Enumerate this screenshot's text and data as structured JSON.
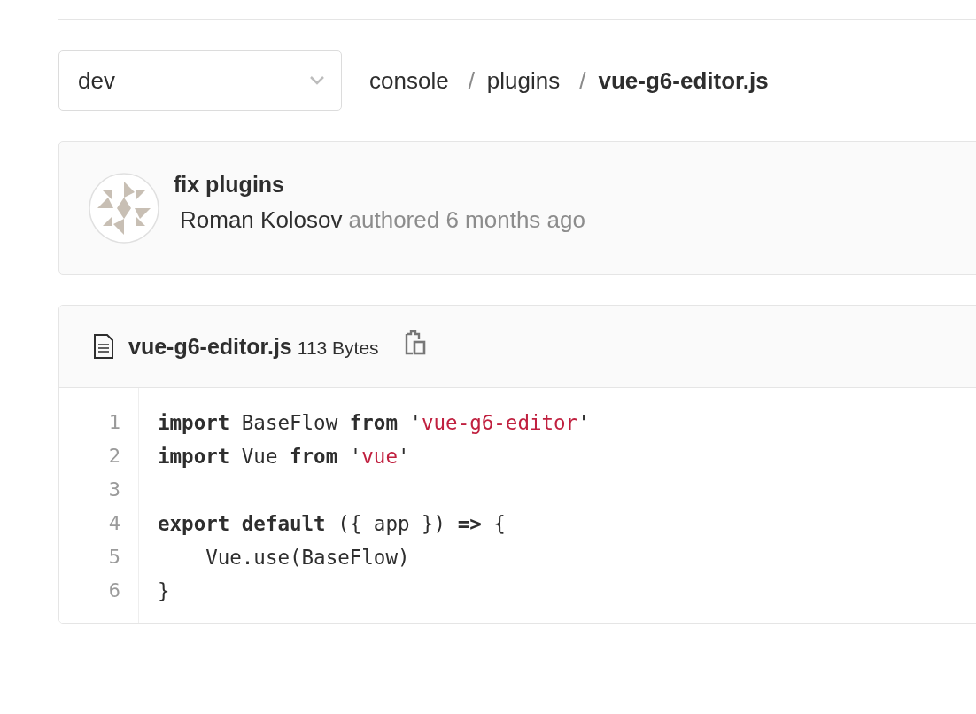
{
  "branch_selector": {
    "value": "dev"
  },
  "breadcrumb": [
    {
      "label": "console",
      "current": false
    },
    {
      "separator": "/",
      "label": "plugins",
      "current": false
    },
    {
      "separator": "/",
      "label": "vue-g6-editor.js",
      "current": true
    }
  ],
  "commit": {
    "message": "fix plugins",
    "author": "Roman Kolosov",
    "time": "authored 6 months ago"
  },
  "file": {
    "name": "vue-g6-editor.js",
    "size": "113 Bytes",
    "lines": [
      {
        "number": "1",
        "tokens": [
          {
            "kind": "keyword",
            "text": "import"
          },
          {
            "kind": "plain",
            "text": " BaseFlow "
          },
          {
            "kind": "keyword",
            "text": "from"
          },
          {
            "kind": "plain",
            "text": " '"
          },
          {
            "kind": "string",
            "text": "vue-g6-editor"
          },
          {
            "kind": "plain",
            "text": "'"
          }
        ]
      },
      {
        "number": "2",
        "tokens": [
          {
            "kind": "keyword",
            "text": "import"
          },
          {
            "kind": "plain",
            "text": " Vue "
          },
          {
            "kind": "keyword",
            "text": "from"
          },
          {
            "kind": "plain",
            "text": " '"
          },
          {
            "kind": "string",
            "text": "vue"
          },
          {
            "kind": "plain",
            "text": "'"
          }
        ]
      },
      {
        "number": "3"
      },
      {
        "number": "4",
        "tokens": [
          {
            "kind": "keyword",
            "text": "export default"
          },
          {
            "kind": "plain",
            "text": " ({ app }) "
          },
          {
            "kind": "keyword",
            "text": "=>"
          },
          {
            "kind": "plain",
            "text": " {"
          }
        ]
      },
      {
        "number": "5",
        "tokens": [
          {
            "kind": "plain",
            "text": "    Vue.use(BaseFlow)"
          }
        ]
      },
      {
        "number": "6",
        "tokens": [
          {
            "kind": "plain",
            "text": "}"
          }
        ]
      }
    ]
  }
}
